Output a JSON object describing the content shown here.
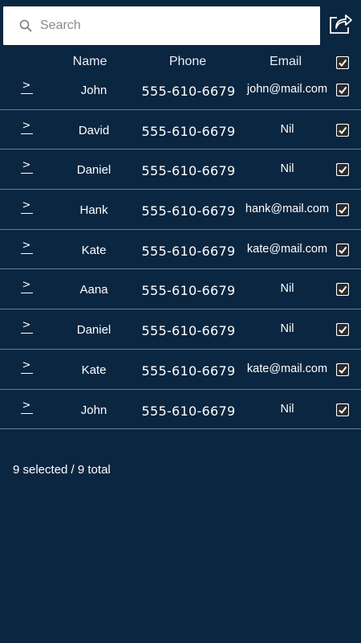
{
  "search": {
    "placeholder": "Search"
  },
  "header": {
    "name_label": "Name",
    "phone_label": "Phone",
    "email_label": "Email",
    "select_all_checked": true
  },
  "contacts": [
    {
      "name": "John",
      "phone": "555-610-6679",
      "email": "john@mail.com",
      "checked": true
    },
    {
      "name": "David",
      "phone": "555-610-6679",
      "email": "Nil",
      "checked": true
    },
    {
      "name": "Daniel",
      "phone": "555-610-6679",
      "email": "Nil",
      "checked": true
    },
    {
      "name": "Hank",
      "phone": "555-610-6679",
      "email": "hank@mail.com",
      "checked": true
    },
    {
      "name": "Kate",
      "phone": "555-610-6679",
      "email": "kate@mail.com",
      "checked": true
    },
    {
      "name": "Aana",
      "phone": "555-610-6679",
      "email": "Nil",
      "checked": true
    },
    {
      "name": "Daniel",
      "phone": "555-610-6679",
      "email": "Nil",
      "checked": true
    },
    {
      "name": "Kate",
      "phone": "555-610-6679",
      "email": "kate@mail.com",
      "checked": true
    },
    {
      "name": "John",
      "phone": "555-610-6679",
      "email": "Nil",
      "checked": true
    }
  ],
  "footer": {
    "status": "9 selected / 9 total"
  },
  "icons": {
    "search": "search-icon",
    "share": "share-icon",
    "chevron": "chevron-right-icon",
    "check": "checkmark-icon"
  },
  "colors": {
    "background": "#0b2640",
    "divider": "#6b7f93",
    "text": "#ffffff"
  }
}
